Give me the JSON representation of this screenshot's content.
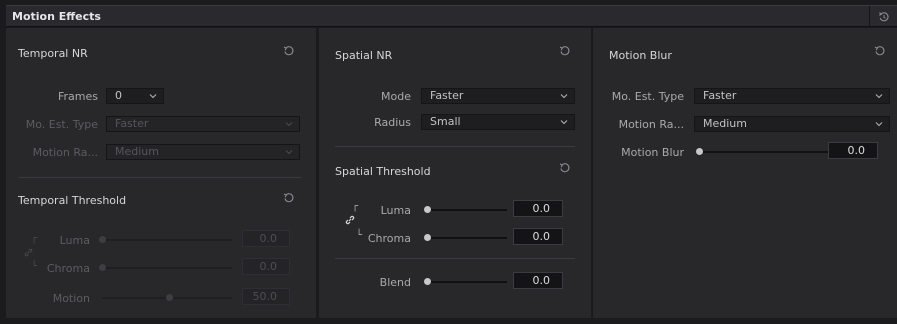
{
  "header": {
    "title": "Motion Effects"
  },
  "temporal_nr": {
    "title": "Temporal NR",
    "frames_label": "Frames",
    "frames_value": "0",
    "mo_est_label": "Mo. Est. Type",
    "mo_est_value": "Faster",
    "motion_range_label": "Motion Ra...",
    "motion_range_value": "Medium"
  },
  "temporal_threshold": {
    "title": "Temporal Threshold",
    "luma_label": "Luma",
    "luma_value": "0.0",
    "chroma_label": "Chroma",
    "chroma_value": "0.0",
    "motion_label": "Motion",
    "motion_value": "50.0"
  },
  "spatial_nr": {
    "title": "Spatial NR",
    "mode_label": "Mode",
    "mode_value": "Faster",
    "radius_label": "Radius",
    "radius_value": "Small"
  },
  "spatial_threshold": {
    "title": "Spatial Threshold",
    "luma_label": "Luma",
    "luma_value": "0.0",
    "chroma_label": "Chroma",
    "chroma_value": "0.0",
    "blend_label": "Blend",
    "blend_value": "0.0"
  },
  "motion_blur": {
    "title": "Motion Blur",
    "mo_est_label": "Mo. Est. Type",
    "mo_est_value": "Faster",
    "motion_range_label": "Motion Ra...",
    "motion_range_value": "Medium",
    "blur_label": "Motion Blur",
    "blur_value": "0.0"
  },
  "icons": {
    "reset": "reset-icon",
    "header_reset": "history-reset-icon",
    "dropdown": "chevron-down-icon",
    "link": "link-icon"
  }
}
